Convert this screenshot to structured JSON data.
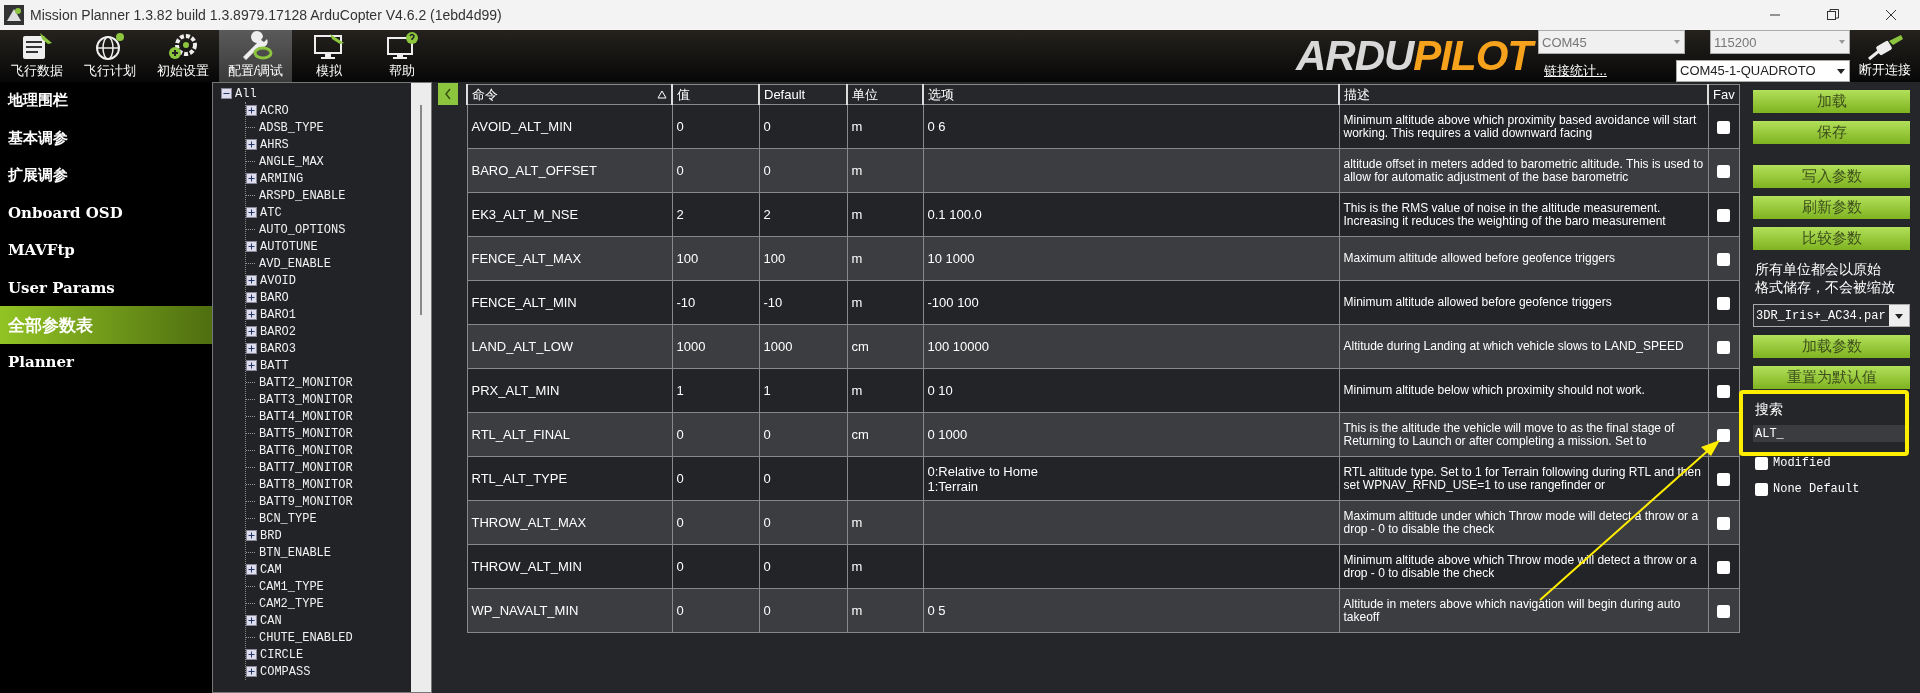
{
  "window": {
    "title": "Mission Planner 1.3.82 build 1.3.8979.17128 ArduCopter V4.6.2 (1ebd4d99)"
  },
  "toolbar": [
    {
      "label": "飞行数据",
      "selected": false
    },
    {
      "label": "飞行计划",
      "selected": false
    },
    {
      "label": "初始设置",
      "selected": false
    },
    {
      "label": "配置/调试",
      "selected": true
    },
    {
      "label": "模拟",
      "selected": false
    },
    {
      "label": "帮助",
      "selected": false
    }
  ],
  "logo": {
    "left": "ARDU",
    "right": "PILOT"
  },
  "connection": {
    "port": "COM45",
    "baud": "115200",
    "link_stats": "链接统计...",
    "vehicle": "COM45-1-QUADROTO",
    "disconnect": "断开连接"
  },
  "sidebar": {
    "items": [
      {
        "label": "地理围栏",
        "selected": false
      },
      {
        "label": "基本调参",
        "selected": false
      },
      {
        "label": "扩展调参",
        "selected": false
      },
      {
        "label": "Onboard OSD",
        "selected": false
      },
      {
        "label": "MAVFtp",
        "selected": false
      },
      {
        "label": "User Params",
        "selected": false
      },
      {
        "label": "全部参数表",
        "selected": true
      },
      {
        "label": "Planner",
        "selected": false
      }
    ]
  },
  "tree": {
    "label": "All",
    "kind": "group",
    "expanded": true,
    "children": [
      {
        "label": "ACRO",
        "kind": "group",
        "expanded": false
      },
      {
        "label": "ADSB_TYPE",
        "kind": "param"
      },
      {
        "label": "AHRS",
        "kind": "group",
        "expanded": false
      },
      {
        "label": "ANGLE_MAX",
        "kind": "param"
      },
      {
        "label": "ARMING",
        "kind": "group",
        "expanded": false
      },
      {
        "label": "ARSPD_ENABLE",
        "kind": "param"
      },
      {
        "label": "ATC",
        "kind": "group",
        "expanded": false
      },
      {
        "label": "AUTO_OPTIONS",
        "kind": "param"
      },
      {
        "label": "AUTOTUNE",
        "kind": "group",
        "expanded": false
      },
      {
        "label": "AVD_ENABLE",
        "kind": "param"
      },
      {
        "label": "AVOID",
        "kind": "group",
        "expanded": false
      },
      {
        "label": "BARO",
        "kind": "group",
        "expanded": false
      },
      {
        "label": "BARO1",
        "kind": "group",
        "expanded": false
      },
      {
        "label": "BARO2",
        "kind": "group",
        "expanded": false
      },
      {
        "label": "BARO3",
        "kind": "group",
        "expanded": false
      },
      {
        "label": "BATT",
        "kind": "group",
        "expanded": false
      },
      {
        "label": "BATT2_MONITOR",
        "kind": "param"
      },
      {
        "label": "BATT3_MONITOR",
        "kind": "param"
      },
      {
        "label": "BATT4_MONITOR",
        "kind": "param"
      },
      {
        "label": "BATT5_MONITOR",
        "kind": "param"
      },
      {
        "label": "BATT6_MONITOR",
        "kind": "param"
      },
      {
        "label": "BATT7_MONITOR",
        "kind": "param"
      },
      {
        "label": "BATT8_MONITOR",
        "kind": "param"
      },
      {
        "label": "BATT9_MONITOR",
        "kind": "param"
      },
      {
        "label": "BCN_TYPE",
        "kind": "param"
      },
      {
        "label": "BRD",
        "kind": "group",
        "expanded": false
      },
      {
        "label": "BTN_ENABLE",
        "kind": "param"
      },
      {
        "label": "CAM",
        "kind": "group",
        "expanded": false
      },
      {
        "label": "CAM1_TYPE",
        "kind": "param"
      },
      {
        "label": "CAM2_TYPE",
        "kind": "param"
      },
      {
        "label": "CAN",
        "kind": "group",
        "expanded": false
      },
      {
        "label": "CHUTE_ENABLED",
        "kind": "param"
      },
      {
        "label": "CIRCLE",
        "kind": "group",
        "expanded": false
      },
      {
        "label": "COMPASS",
        "kind": "group",
        "expanded": false
      }
    ]
  },
  "table": {
    "columns": [
      "命令",
      "值",
      "Default",
      "单位",
      "选项",
      "描述",
      "Fav"
    ],
    "rows": [
      {
        "name": "AVOID_ALT_MIN",
        "value": "0",
        "default": "0",
        "unit": "m",
        "options": "0 6",
        "description": "Minimum altitude above which proximity based avoidance will start working. This requires a valid downward facing",
        "fav": false
      },
      {
        "name": "BARO_ALT_OFFSET",
        "value": "0",
        "default": "0",
        "unit": "m",
        "options": "",
        "description": "altitude offset in meters added to barometric altitude. This is used to allow for automatic adjustment of the base barometric",
        "fav": false
      },
      {
        "name": "EK3_ALT_M_NSE",
        "value": "2",
        "default": "2",
        "unit": "m",
        "options": "0.1 100.0",
        "description": "This is the RMS value of noise in the altitude measurement. Increasing it reduces the weighting of the baro measurement",
        "fav": false
      },
      {
        "name": "FENCE_ALT_MAX",
        "value": "100",
        "default": "100",
        "unit": "m",
        "options": "10 1000",
        "description": "Maximum altitude allowed before geofence triggers",
        "fav": false
      },
      {
        "name": "FENCE_ALT_MIN",
        "value": "-10",
        "default": "-10",
        "unit": "m",
        "options": "-100 100",
        "description": "Minimum altitude allowed before geofence triggers",
        "fav": false
      },
      {
        "name": "LAND_ALT_LOW",
        "value": "1000",
        "default": "1000",
        "unit": "cm",
        "options": "100 10000",
        "description": "Altitude during Landing at which vehicle slows to LAND_SPEED",
        "fav": false
      },
      {
        "name": "PRX_ALT_MIN",
        "value": "1",
        "default": "1",
        "unit": "m",
        "options": "0 10",
        "description": "Minimum altitude below which proximity should not work.",
        "fav": false
      },
      {
        "name": "RTL_ALT_FINAL",
        "value": "0",
        "default": "0",
        "unit": "cm",
        "options": "0 1000",
        "description": "This is the altitude the vehicle will move to as the final stage of Returning to Launch or after completing a mission.  Set to",
        "fav": false
      },
      {
        "name": "RTL_ALT_TYPE",
        "value": "0",
        "default": "0",
        "unit": "",
        "options": "0:Relative to Home\n1:Terrain",
        "description": "RTL altitude type.  Set to 1 for Terrain following during RTL and then set WPNAV_RFND_USE=1 to use rangefinder or",
        "fav": false
      },
      {
        "name": "THROW_ALT_MAX",
        "value": "0",
        "default": "0",
        "unit": "m",
        "options": "",
        "description": "Maximum altitude under which Throw mode will detect a throw or a drop - 0 to disable the check",
        "fav": false
      },
      {
        "name": "THROW_ALT_MIN",
        "value": "0",
        "default": "0",
        "unit": "m",
        "options": "",
        "description": "Minimum altitude above which Throw mode will detect a throw or a drop - 0 to disable the check",
        "fav": false
      },
      {
        "name": "WP_NAVALT_MIN",
        "value": "0",
        "default": "0",
        "unit": "m",
        "options": "0 5",
        "description": "Altitude in meters above which navigation will begin during auto takeoff",
        "fav": false
      }
    ]
  },
  "actions": {
    "buttons_top": [
      "加载",
      "保存"
    ],
    "buttons_mid": [
      "写入参数",
      "刷新参数",
      "比较参数"
    ],
    "note": [
      "所有单位都会以原始",
      "格式储存，不会被缩放"
    ],
    "param_file": "3DR_Iris+_AC34.par",
    "buttons_bottom": [
      "加载参数",
      "重置为默认值"
    ],
    "search": {
      "label": "搜索",
      "value": "ALT_"
    },
    "filters": [
      {
        "label": "Modified",
        "checked": false
      },
      {
        "label": "None Default",
        "checked": false
      }
    ]
  }
}
